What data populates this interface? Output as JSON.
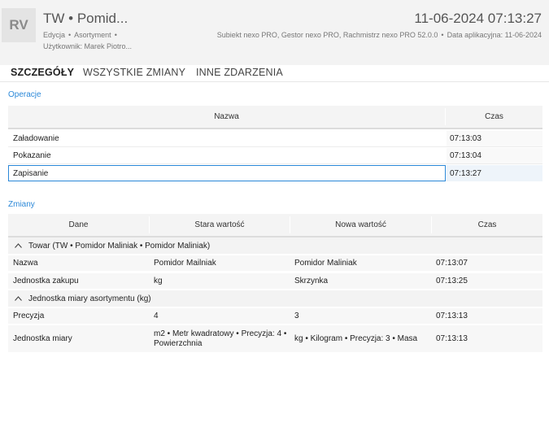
{
  "header": {
    "badge": "RV",
    "title": "TW • Pomid...",
    "timestamp": "11-06-2024 07:13:27",
    "meta_items": [
      "Edycja",
      "Asortyment"
    ],
    "meta_sep": "•",
    "user_line": "Użytkownik: Marek Piotro...",
    "app_info": "Subiekt nexo PRO, Gestor nexo PRO, Rachmistrz nexo PRO 52.0.0",
    "date_info": "Data aplikacyjna: 11-06-2024"
  },
  "tabs": [
    {
      "label": "SZCZEGÓŁY",
      "active": true
    },
    {
      "label": "WSZYSTKIE ZMIANY",
      "active": false
    },
    {
      "label": "INNE ZDARZENIA",
      "active": false
    }
  ],
  "operations": {
    "section_title": "Operacje",
    "columns": [
      "Nazwa",
      "Czas"
    ],
    "rows": [
      {
        "name": "Załadowanie",
        "time": "07:13:03"
      },
      {
        "name": "Pokazanie",
        "time": "07:13:04"
      },
      {
        "name": "Zapisanie",
        "time": "07:13:27",
        "selected": true
      }
    ]
  },
  "changes": {
    "section_title": "Zmiany",
    "columns": [
      "Dane",
      "Stara wartość",
      "Nowa wartość",
      "Czas"
    ],
    "groups": [
      {
        "title": "Towar (TW • Pomidor Maliniak • Pomidor Maliniak)",
        "rows": [
          {
            "field": "Nazwa",
            "old": "Pomidor Mailniak",
            "new": "Pomidor Maliniak",
            "time": "07:13:07"
          },
          {
            "field": "Jednostka zakupu",
            "old": "kg",
            "new": "Skrzynka",
            "time": "07:13:25"
          }
        ]
      },
      {
        "title": "Jednostka miary asortymentu (kg)",
        "rows": [
          {
            "field": "Precyzja",
            "old": "4",
            "new": "3",
            "time": "07:13:13"
          },
          {
            "field": "Jednostka miary",
            "old": "m2 • Metr kwadratowy • Precyzja: 4 • Powierzchnia",
            "new": "kg • Kilogram • Precyzja: 3 • Masa",
            "time": "07:13:13"
          }
        ]
      }
    ]
  },
  "colors": {
    "accent": "#2b88d8",
    "header_bg": "#f3f3f3"
  },
  "icons": {
    "group_collapse": "chevron-up-icon"
  }
}
